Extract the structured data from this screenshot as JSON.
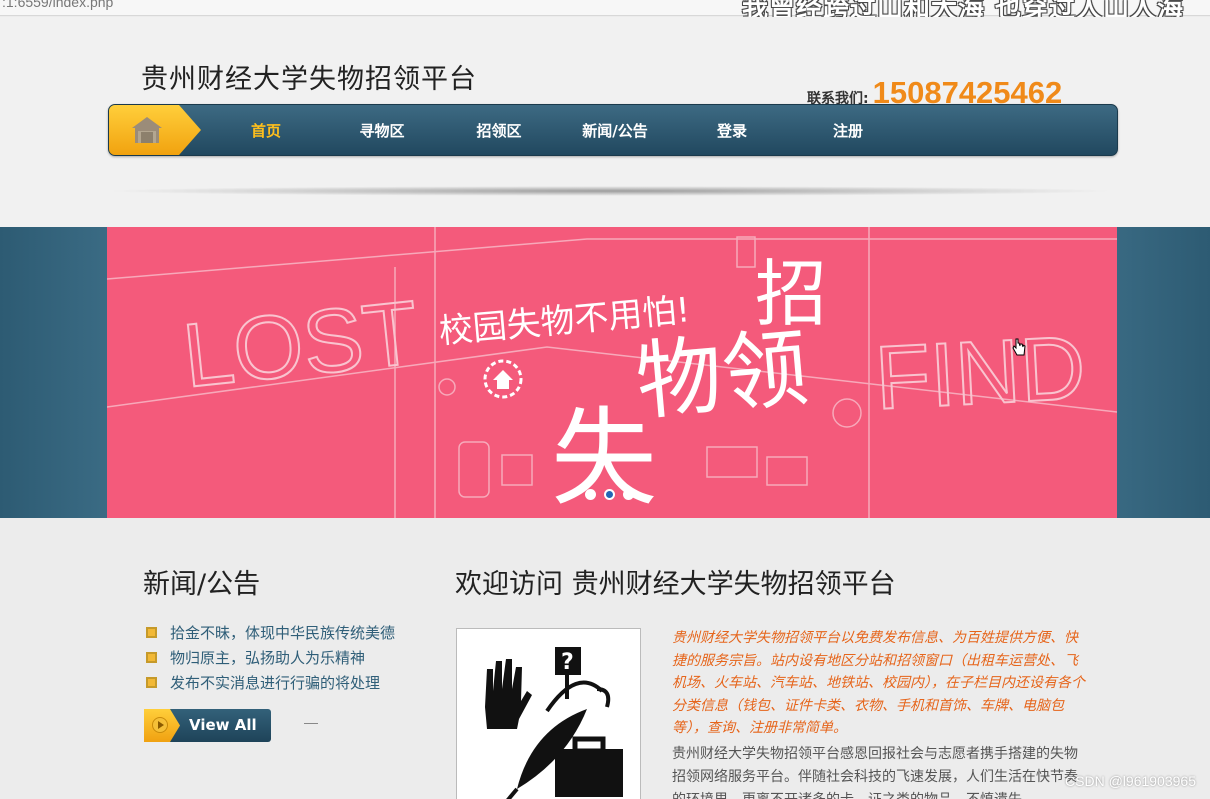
{
  "browser": {
    "url_fragment": ":1:6559/index.php"
  },
  "overlay": {
    "caption": "我曾经跨过山和大海 也穿过人山人海"
  },
  "header": {
    "site_title": "贵州财经大学失物招领平台",
    "contact_label": "联系我们:",
    "contact_phone": "15087425462"
  },
  "nav": {
    "items": [
      {
        "label": "首页",
        "active": true
      },
      {
        "label": "寻物区",
        "active": false
      },
      {
        "label": "招领区",
        "active": false
      },
      {
        "label": "新闻/公告",
        "active": false
      },
      {
        "label": "登录",
        "active": false
      },
      {
        "label": "注册",
        "active": false
      }
    ]
  },
  "banner": {
    "headline": "校园失物不用怕!",
    "big_text": [
      "招",
      "物领",
      "失"
    ],
    "left_word": "LOST",
    "right_word": "FIND",
    "slide_count": 3,
    "active_slide": 2,
    "background": "#f45a7b"
  },
  "news": {
    "title": "新闻/公告",
    "items": [
      "拾金不昧，体现中华民族传统美德",
      "物归原主，弘扬助人为乐精神",
      "发布不实消息进行行骗的将处理"
    ],
    "view_all": "View All"
  },
  "welcome": {
    "title": "欢迎访问 贵州财经大学失物招领平台",
    "intro_orange": "贵州财经大学失物招领平台以免费发布信息、为百姓提供方便、快捷的服务宗旨。站内设有地区分站和招领窗口（出租车运营处、飞机场、火车站、汽车站、地铁站、校园内），在子栏目内还设有各个分类信息（钱包、证件卡类、衣物、手机和首饰、车牌、电脑包等），查询、注册非常简单。",
    "intro_body": "贵州财经大学失物招领平台感恩回报社会与志愿者携手搭建的失物招领网络服务平台。伴随社会科技的飞速发展，人们生活在快节奏的环境里，更离不开诸多的卡、证之类的物品，不慎遗失"
  },
  "watermark": "CSDN @l961903965",
  "colors": {
    "accent": "#f08a19",
    "nav": "#2b5670",
    "banner": "#f45a7b",
    "active_nav": "#ffbf1c"
  }
}
